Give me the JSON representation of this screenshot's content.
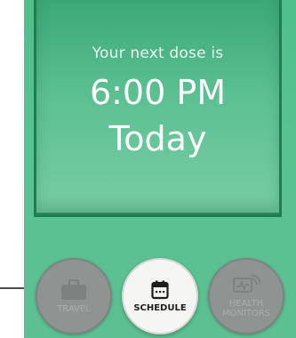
{
  "dose_card": {
    "label": "Your next dose is",
    "time": "6:00 PM",
    "day": "Today"
  },
  "nav": {
    "items": [
      {
        "label": "TRAVEL",
        "icon": "briefcase-icon",
        "active": false
      },
      {
        "label": "SCHEDULE",
        "icon": "calendar-icon",
        "active": true
      },
      {
        "label": "HEALTH\nMONITORS",
        "icon": "health-monitor-icon",
        "active": false
      }
    ]
  },
  "colors": {
    "background": "#5dc093",
    "card_border": "#1f7d52",
    "inactive_button": "#8f9492",
    "active_button": "#f5f5f3"
  }
}
